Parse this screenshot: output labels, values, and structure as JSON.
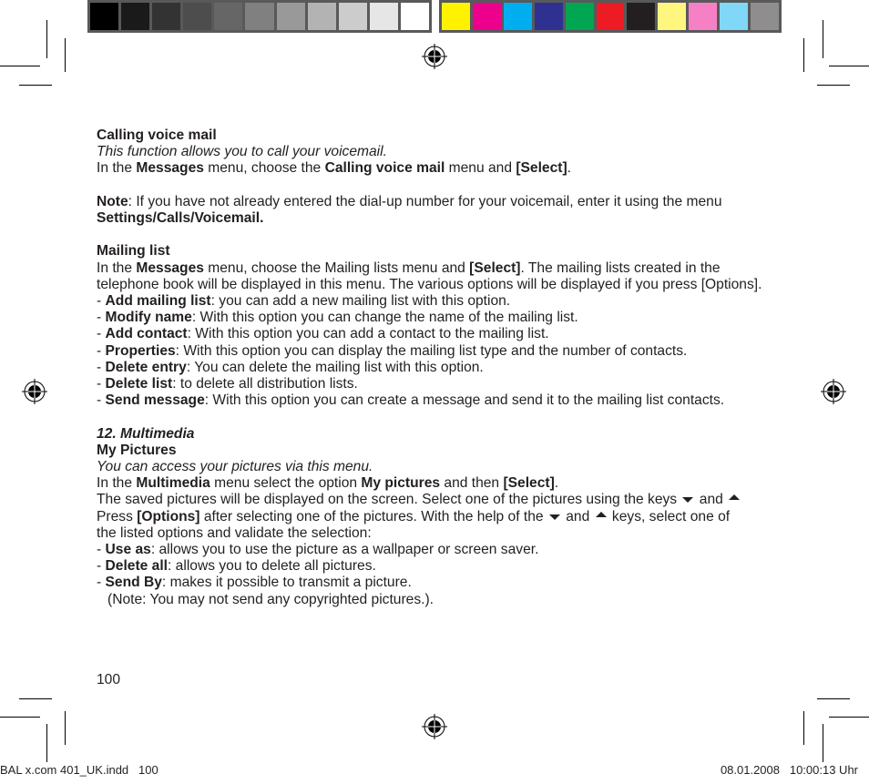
{
  "colorbar": {
    "grays": [
      "#000000",
      "#1a1a1a",
      "#333333",
      "#4d4d4d",
      "#666666",
      "#808080",
      "#999999",
      "#b3b3b3",
      "#cccccc",
      "#e6e6e6",
      "#ffffff"
    ],
    "colors": [
      "#fff200",
      "#ec008c",
      "#00aeef",
      "#2e3192",
      "#00a651",
      "#ed1c24",
      "#231f20",
      "#fff67f",
      "#f680c5",
      "#80d7f7",
      "#8f8d8e"
    ]
  },
  "voicemail": {
    "heading": "Calling voice mail",
    "intro": "This function allows you to call your voicemail.",
    "line1_a": "In the ",
    "line1_b": "Messages",
    "line1_c": " menu, choose the ",
    "line1_d": "Calling voice mail",
    "line1_e": " menu and ",
    "line1_f": "[Select]",
    "line1_g": ".",
    "note_label": "Note",
    "note_text": ": If you have not already entered the dial-up number for your voicemail, enter it using the menu ",
    "note_menu": "Settings/Calls/Voicemail."
  },
  "mailing": {
    "heading": "Mailing list",
    "p_a": "In the ",
    "p_b": "Messages",
    "p_c": " menu, choose the Mailing lists menu and ",
    "p_d": "[Select]",
    "p_e": ". The mailing lists created in the telephone book will be displayed in this menu. The various options will be displayed if you press [Options].",
    "items": [
      {
        "term": "Add mailing list",
        "desc": ": you can add a new mailing list with this option."
      },
      {
        "term": "Modify name",
        "desc": ": With this option you can change the name of the mailing list."
      },
      {
        "term": "Add contact",
        "desc": ": With this option you can add a contact to the mailing list."
      },
      {
        "term": "Properties",
        "desc": ": With this option you can display the mailing list type and the number of contacts."
      },
      {
        "term": "Delete entry",
        "desc": ": You can delete the mailing list with this option."
      },
      {
        "term": "Delete list",
        "desc": ": to delete all distribution lists."
      },
      {
        "term": "Send message",
        "desc": ": With this option you can create a message and send it to the mailing list contacts."
      }
    ]
  },
  "multimedia": {
    "section": "12. Multimedia",
    "heading": "My Pictures",
    "intro": "You can access your pictures via this menu.",
    "l1_a": "In the ",
    "l1_b": "Multimedia",
    "l1_c": " menu select the option ",
    "l1_d": "My pictures",
    "l1_e": " and then ",
    "l1_f": "[Select]",
    "l1_g": ".",
    "p2_a": "The saved pictures will be displayed on the screen. Select one of the pictures using the keys ",
    "p2_and1": " and ",
    "p2_b": " Press ",
    "p2_c": "[Options]",
    "p2_d": " after selecting one of the pictures. With the help of the ",
    "p2_and2": " and ",
    "p2_e": " keys, select one of the listed options and validate the selection:",
    "items": [
      {
        "term": "Use as",
        "desc": ": allows you to use the picture as a wallpaper or screen saver."
      },
      {
        "term": "Delete all",
        "desc": ": allows you to delete all pictures."
      },
      {
        "term": "Send By",
        "desc": ": makes it possible to transmit a picture."
      }
    ],
    "note": "(Note: You may not send any copyrighted pictures.)."
  },
  "page_number": "100",
  "slug": {
    "file": "BAL x.com 401_UK.indd   100",
    "date": "08.01.2008   10:00:13 Uhr"
  }
}
